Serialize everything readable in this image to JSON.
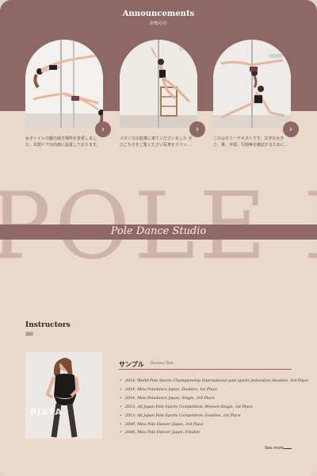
{
  "announcements": {
    "title": "Announcements",
    "subtitle": "お知らせ",
    "cards": [
      {
        "text": "女子トイレの鍵の開き場所を変更しました。玄関ドアの内側に設置しております。",
        "arrow": "›"
      },
      {
        "text": "スタジオの駐車に来てくださいました ゼロこちらをご覧ください写真をクリッ…",
        "arrow": "›"
      },
      {
        "text": "これはダミーテキストです。文字の大きさ、量、字間、行間等を確認するために…",
        "arrow": "›"
      }
    ]
  },
  "hero": {
    "big_word": "POLE D",
    "studio_label": "Pole Dance Studio"
  },
  "instructors": {
    "title": "Instructors",
    "subtitle": "講師",
    "watermark": "PIXTA",
    "name": "サンプル",
    "name_en": "Dummy Text",
    "awards": [
      "2014, World Pole Sports Championship International pole sports federation Doubles, 3rd Place",
      "2014, Miss Poledance Japan, Doubles, 1st Place",
      "2014, Miss Poledance Japan, Single, 3rd Place",
      "2013, All Japan Pole Sports Competition, Women Single, 1st Place",
      "2013, All Japan Pole Sports Competition, Doubles, 1st Place",
      "2009, Miss Pole Dancer Japan, 3rd Place",
      "2008, Miss Pole Dancer Japan, Finalist"
    ],
    "see_more": "See more"
  },
  "colors": {
    "accent": "#8e6866",
    "background": "#ead9ca",
    "big_word": "#cdb3aa"
  }
}
